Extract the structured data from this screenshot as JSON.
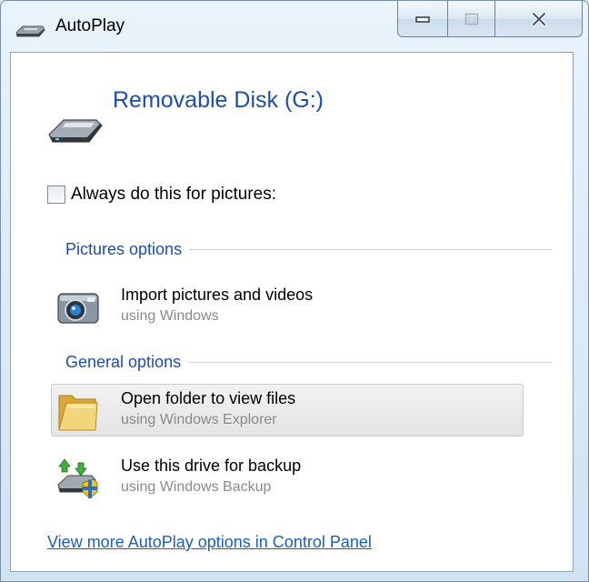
{
  "window": {
    "title": "AutoPlay",
    "title_icon": "removable-drive-icon",
    "caption_buttons": {
      "minimize": "minimize-icon",
      "maximize": "maximize-icon",
      "close": "close-icon"
    }
  },
  "device": {
    "icon": "removable-drive-icon",
    "title": "Removable Disk (G:)"
  },
  "always_do": {
    "label": "Always do this for pictures:",
    "checked": false
  },
  "sections": [
    {
      "title": "Pictures options",
      "options": [
        {
          "icon": "camera-icon",
          "title": "Import pictures and videos",
          "subtitle": "using Windows",
          "highlighted": false
        }
      ]
    },
    {
      "title": "General options",
      "options": [
        {
          "icon": "folder-icon",
          "title": "Open folder to view files",
          "subtitle": "using Windows Explorer",
          "highlighted": true
        },
        {
          "icon": "backup-drive-icon",
          "title": "Use this drive for backup",
          "subtitle": "using Windows Backup",
          "highlighted": false
        }
      ]
    }
  ],
  "footer": {
    "link": "View more AutoPlay options in Control Panel"
  },
  "colors": {
    "heading_blue": "#1e4eab",
    "link_blue": "#1a5fbf",
    "subtext_gray": "#8a8a8a"
  }
}
